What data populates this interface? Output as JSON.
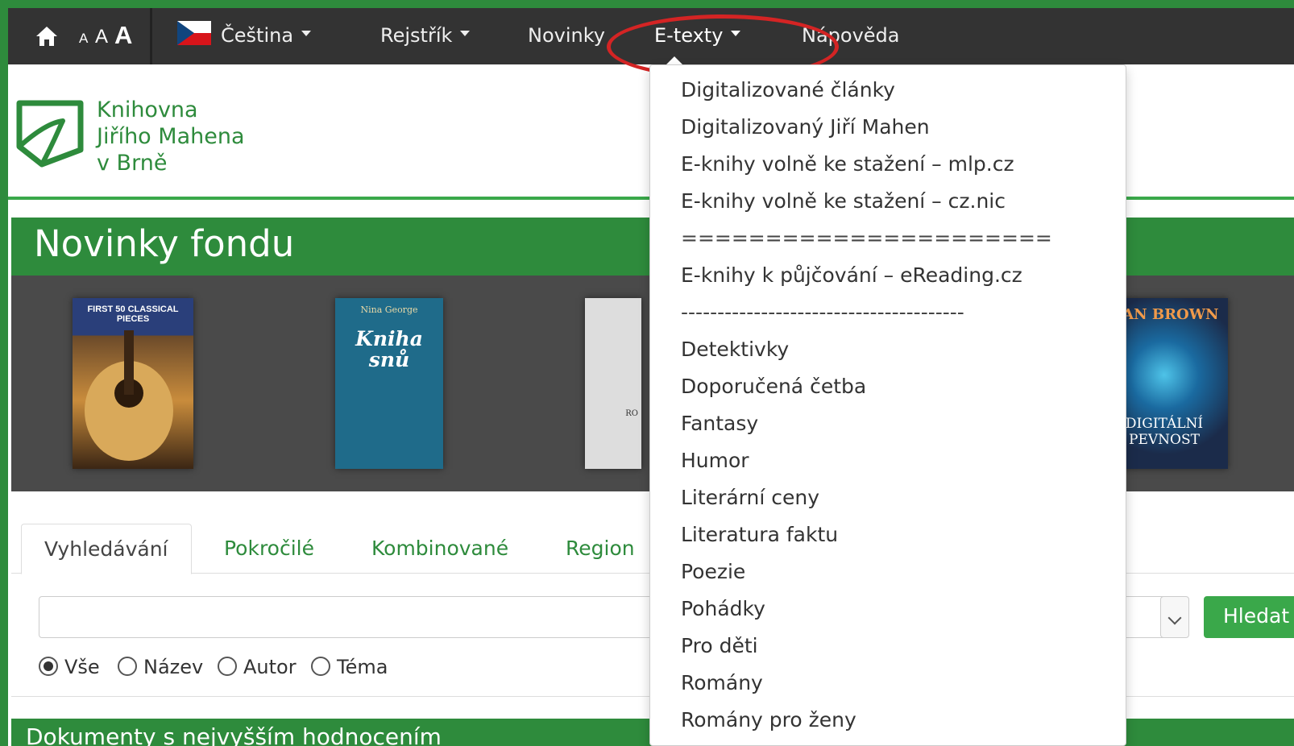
{
  "colors": {
    "brand_green": "#2e8b3c",
    "navbar": "#333333",
    "highlight": "#d42424"
  },
  "navbar": {
    "home_icon": "home-icon",
    "font_size_small": "A",
    "font_size_medium": "A",
    "font_size_large": "A",
    "language": "Čeština",
    "language_flag": "czech-flag-icon",
    "index": "Rejstřík",
    "news": "Novinky",
    "etexts": "E-texty",
    "help": "Nápověda"
  },
  "logo": {
    "line1": "Knihovna",
    "line2": "Jiřího Mahena",
    "line3": "v Brně"
  },
  "news": {
    "title": "Novinky fondu",
    "books": [
      {
        "top_text": "FIRST 50 CLASSICAL PIECES"
      },
      {
        "author": "Nina George",
        "title": "Kniha snů"
      },
      {
        "label": "RO"
      },
      {
        "author": "DAN BROWN",
        "title": "DIGITÁLNÍ PEVNOST"
      }
    ]
  },
  "tabs": [
    "Vyhledávání",
    "Pokročilé",
    "Kombinované",
    "Region"
  ],
  "search": {
    "value": "",
    "button": "Hledat"
  },
  "radios": [
    {
      "label": "Vše",
      "checked": true
    },
    {
      "label": "Název",
      "checked": false
    },
    {
      "label": "Autor",
      "checked": false
    },
    {
      "label": "Téma",
      "checked": false
    }
  ],
  "bottom_section_title": "Dokumenty s nejvyšším hodnocením",
  "dropdown": {
    "items": [
      "Digitalizované články",
      "Digitalizovaný Jiří Mahen",
      "E-knihy volně ke stažení – mlp.cz",
      "E-knihy volně ke stažení – cz.nic",
      "======================",
      "E-knihy k půjčování – eReading.cz",
      "---------------------------------------",
      "Detektivky",
      "Doporučená četba",
      "Fantasy",
      "Humor",
      "Literární ceny",
      "Literatura faktu",
      "Poezie",
      "Pohádky",
      "Pro děti",
      "Romány",
      "Romány pro ženy"
    ]
  }
}
